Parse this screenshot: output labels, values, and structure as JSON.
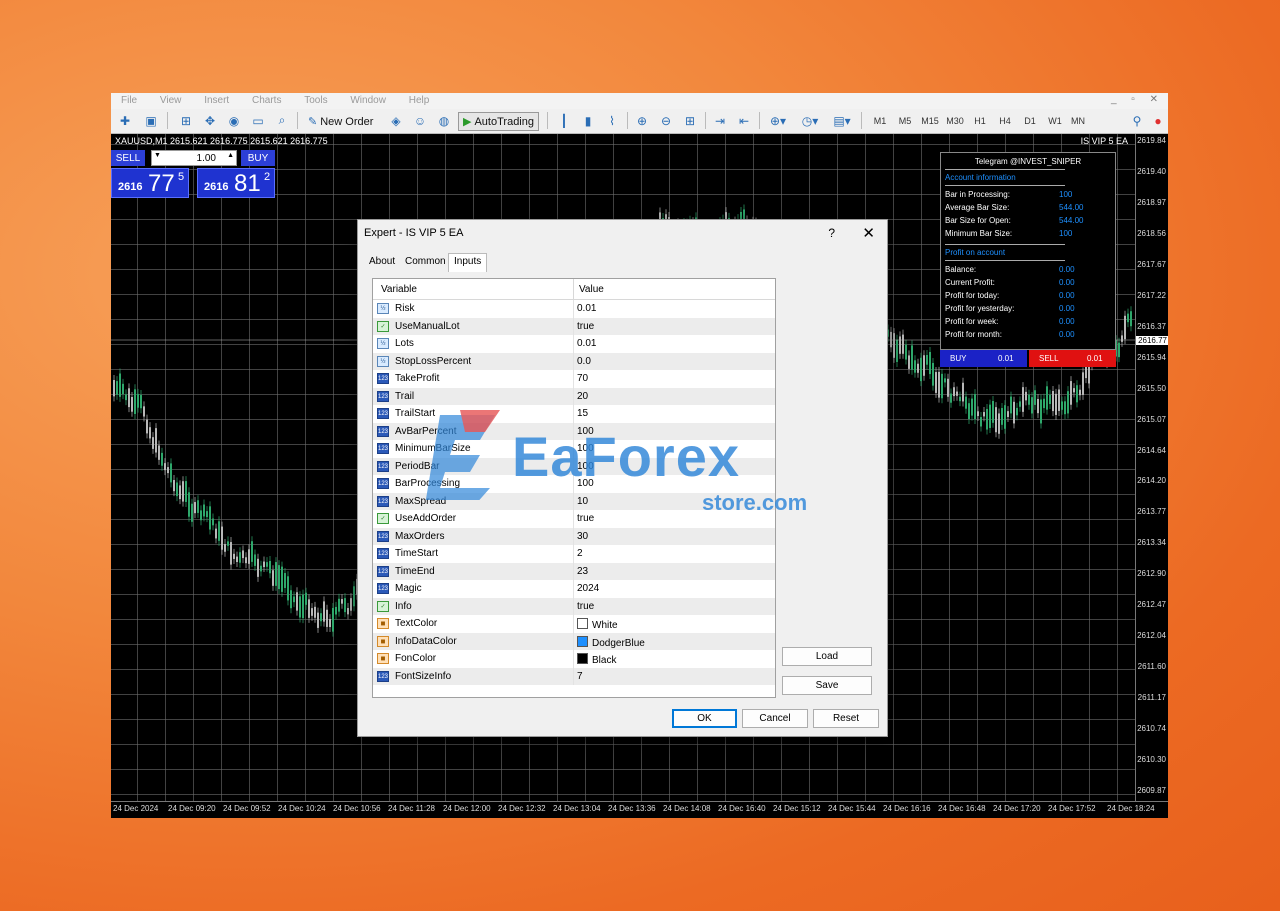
{
  "menu": [
    "File",
    "View",
    "Insert",
    "Charts",
    "Tools",
    "Window",
    "Help"
  ],
  "toolbar": {
    "new_order": "New Order",
    "auto_trading": "AutoTrading",
    "timeframes": [
      "M1",
      "M5",
      "M15",
      "M30",
      "H1",
      "H4",
      "D1",
      "W1",
      "MN"
    ]
  },
  "chart": {
    "symbol_label": "XAUUSD,M1  2615.621 2616.775 2615.621 2616.775",
    "ea_label": "IS VIP 5 EA",
    "price_labels": [
      "2619.84",
      "2619.40",
      "2618.97",
      "2618.56",
      "2617.67",
      "2617.22",
      "2616.37",
      "2615.94",
      "2615.50",
      "2615.07",
      "2614.64",
      "2614.20",
      "2613.77",
      "2613.34",
      "2612.90",
      "2612.47",
      "2612.04",
      "2611.60",
      "2611.17",
      "2610.74",
      "2610.30",
      "2609.87"
    ],
    "current_price": "2616.77",
    "time_labels": [
      "24 Dec 2024",
      "24 Dec 09:20",
      "24 Dec 09:52",
      "24 Dec 10:24",
      "24 Dec 10:56",
      "24 Dec 11:28",
      "24 Dec 12:00",
      "24 Dec 12:32",
      "24 Dec 13:04",
      "24 Dec 13:36",
      "24 Dec 14:08",
      "24 Dec 16:40",
      "24 Dec 15:12",
      "24 Dec 15:44",
      "24 Dec 16:16",
      "24 Dec 16:48",
      "24 Dec 17:20",
      "24 Dec 17:52",
      "24 Dec 18:24"
    ]
  },
  "one_click": {
    "sell": "SELL",
    "buy": "BUY",
    "lot": "1.00",
    "sell_small": "2616",
    "sell_big": "77",
    "sell_sup": "5",
    "buy_small": "2616",
    "buy_big": "81",
    "buy_sup": "2"
  },
  "info_panel": {
    "header": "Telegram @INVEST_SNIPER",
    "account_section": "Account information",
    "account_rows": [
      {
        "k": "Bar in Processing:",
        "v": "100"
      },
      {
        "k": "Average Bar Size:",
        "v": "544.00"
      },
      {
        "k": "Bar Size for Open:",
        "v": "544.00"
      },
      {
        "k": "Minimum Bar Size:",
        "v": "100"
      }
    ],
    "profit_section": "Profit on account",
    "profit_rows": [
      {
        "k": "Balance:",
        "v": "0.00"
      },
      {
        "k": "Current Profit:",
        "v": "0.00"
      },
      {
        "k": "Profit for today:",
        "v": "0.00"
      },
      {
        "k": "Profit for yesterday:",
        "v": "0.00"
      },
      {
        "k": "Profit for week:",
        "v": "0.00"
      },
      {
        "k": "Profit for month:",
        "v": "0.00"
      }
    ],
    "buy_label": "BUY",
    "buy_val": "0.01",
    "sell_label": "SELL",
    "sell_val": "0.01"
  },
  "dialog": {
    "title": "Expert - IS VIP 5 EA",
    "help": "?",
    "close": "✕",
    "tabs": [
      "About",
      "Common",
      "Inputs"
    ],
    "col_variable": "Variable",
    "col_value": "Value",
    "params": [
      {
        "name": "Risk",
        "value": "0.01",
        "type": "dbl"
      },
      {
        "name": "UseManualLot",
        "value": "true",
        "type": "bool"
      },
      {
        "name": "Lots",
        "value": "0.01",
        "type": "dbl"
      },
      {
        "name": "StopLossPercent",
        "value": "0.0",
        "type": "dbl"
      },
      {
        "name": "TakeProfit",
        "value": "70",
        "type": "num"
      },
      {
        "name": "Trail",
        "value": "20",
        "type": "num"
      },
      {
        "name": "TrailStart",
        "value": "15",
        "type": "num"
      },
      {
        "name": "AvBarPercent",
        "value": "100",
        "type": "num"
      },
      {
        "name": "MinimumBarSize",
        "value": "100",
        "type": "num"
      },
      {
        "name": "PeriodBar",
        "value": "100",
        "type": "num"
      },
      {
        "name": "BarProcessing",
        "value": "100",
        "type": "num"
      },
      {
        "name": "MaxSpread",
        "value": "10",
        "type": "num"
      },
      {
        "name": "UseAddOrder",
        "value": "true",
        "type": "bool"
      },
      {
        "name": "MaxOrders",
        "value": "30",
        "type": "num"
      },
      {
        "name": "TimeStart",
        "value": "2",
        "type": "num"
      },
      {
        "name": "TimeEnd",
        "value": "23",
        "type": "num"
      },
      {
        "name": "Magic",
        "value": "2024",
        "type": "num"
      },
      {
        "name": "Info",
        "value": "true",
        "type": "bool"
      },
      {
        "name": "TextColor",
        "value": "White",
        "type": "col",
        "swatch": "#ffffff"
      },
      {
        "name": "InfoDataColor",
        "value": "DodgerBlue",
        "type": "col",
        "swatch": "#1e90ff"
      },
      {
        "name": "FonColor",
        "value": "Black",
        "type": "col",
        "swatch": "#000000"
      },
      {
        "name": "FontSizeInfo",
        "value": "7",
        "type": "num"
      }
    ],
    "load": "Load",
    "save": "Save",
    "ok": "OK",
    "cancel": "Cancel",
    "reset": "Reset"
  },
  "watermark": {
    "text": "EaForex",
    "sub": "store.com"
  },
  "colors": {
    "candle_up": "#2ea86b",
    "candle_down": "#b8b8b8",
    "accent": "#0078d7"
  }
}
